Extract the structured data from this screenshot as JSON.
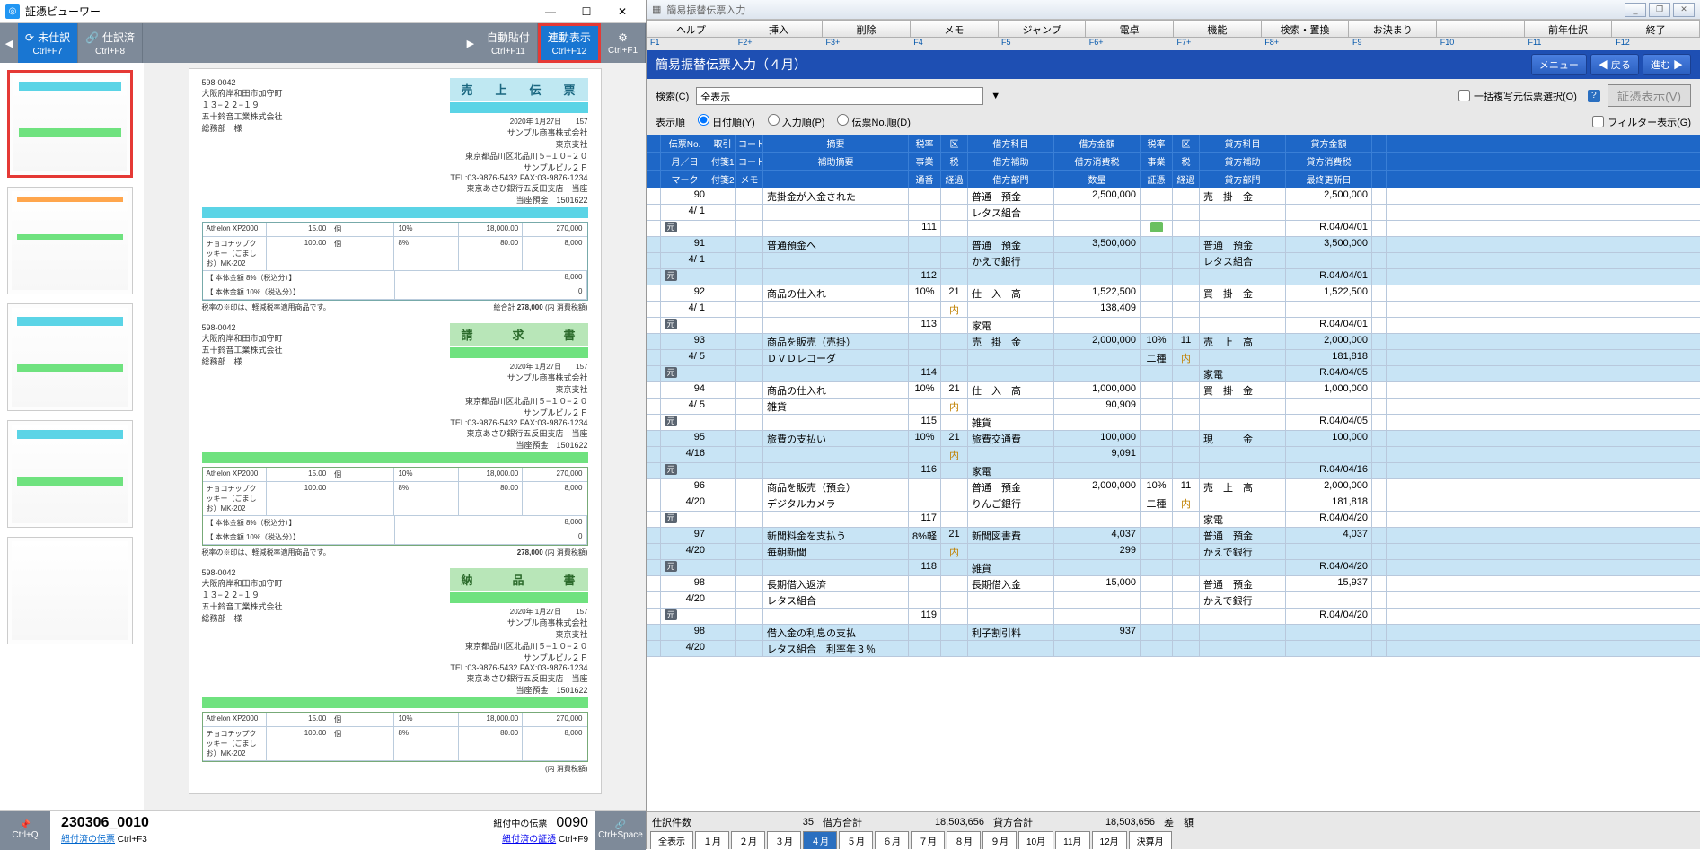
{
  "viewer": {
    "title": "証憑ビューワー",
    "toolbar": {
      "unfinished": "未仕訳",
      "unfinished_key": "Ctrl+F7",
      "finished": "仕訳済",
      "finished_key": "Ctrl+F8",
      "auto_attach": "自動貼付",
      "auto_attach_key": "Ctrl+F11",
      "link_display": "連動表示",
      "link_display_key": "Ctrl+F12",
      "help_key": "Ctrl+F1"
    },
    "doc": {
      "code": "598-0042",
      "addr1": "大阪府岸和田市加守町",
      "addr2": "１３−２２−１９",
      "company": "五十鈴音工業株式会社",
      "dept": "総務部　様",
      "sender": "サンプル商事株式会社",
      "branch": "東京支社",
      "sender_addr": "東京都品川区北品川５−１０−２０",
      "building": "サンプルビル２Ｆ",
      "tel": "TEL:03-9876-5432    FAX:03-9876-1234",
      "bank": "東京あさひ銀行五反田支店　当座",
      "acct": "当座預金　1501622",
      "date": "2020年 1月27日",
      "slip_no": "157",
      "slip1_title": "売　上　伝　票",
      "slip2_title": "請　　求　　書",
      "slip3_title": "納　　品　　書",
      "item1": "Athelon XP2000",
      "item2": "チョコチップクッキー（ごましお）MK-202",
      "base_line1": "【 本体金額 8%（税込分）】",
      "base_line2": "【 本体金額 10%（税込分）】",
      "note": "税率の※印は、軽減税率適用商品です。",
      "qty1": "15.00",
      "qty2": "100.00",
      "unit": "個",
      "rate1": "8%",
      "rate2": "10%",
      "price1": "18,000.00",
      "price2": "80.00",
      "amt1": "270,000",
      "amt2": "8,000",
      "amt3": "0",
      "total": "278,000",
      "tax_label": "(内 消費税額)",
      "subtotal_label": "絵合計"
    },
    "footer": {
      "pin_key": "Ctrl+Q",
      "image_no": "230306_0010",
      "link1": "紐付済の伝票",
      "link1_key": "Ctrl+F3",
      "attach_label": "紐付中の伝票",
      "attach_no": "0090",
      "link2": "紐付済の証憑",
      "link2_key": "Ctrl+F9",
      "space_key": "Ctrl+Space"
    }
  },
  "entry": {
    "title": "簡易振替伝票入力",
    "menus": [
      "ヘルプ",
      "挿入",
      "削除",
      "メモ",
      "ジャンプ",
      "電卓",
      "機能",
      "検索・置換",
      "お決まり",
      "",
      "前年仕訳",
      "終了"
    ],
    "fkeys": [
      "F1",
      "F2+",
      "F3+",
      "F4",
      "F5",
      "F6+",
      "F7+",
      "F8+",
      "F9",
      "F10",
      "F11",
      "F12"
    ],
    "header_title": "簡易振替伝票入力（４月）",
    "btn_menu": "メニュー",
    "btn_back": "◀ 戻る",
    "btn_fwd": "進む ▶",
    "search_label": "検索(C)",
    "search_value": "全表示",
    "bulk_label": "一括複写元伝票選択(O)",
    "evidence_btn": "証憑表示(V)",
    "order_label": "表示順",
    "order_date": "日付順(Y)",
    "order_input": "入力順(P)",
    "order_no": "伝票No.順(D)",
    "filter_label": "フィルター表示(G)",
    "headers": {
      "r1": [
        "伝票No.",
        "取引",
        "コード",
        "摘要",
        "税率",
        "区",
        "借方科目",
        "借方金額",
        "税率",
        "区",
        "貸方科目",
        "貸方金額"
      ],
      "r2": [
        "月／日",
        "付箋1",
        "コード",
        "補助摘要",
        "事業",
        "税",
        "借方補助",
        "借方消費税",
        "事業",
        "税",
        "貸方補助",
        "貸方消費税"
      ],
      "r3": [
        "マーク",
        "付箋2",
        "メモ",
        "",
        "通番",
        "経過",
        "借方部門",
        "数量",
        "証憑",
        "経過",
        "貸方部門",
        "最終更新日"
      ]
    },
    "rows": [
      {
        "no": "90",
        "date": "4/ 1",
        "sum": "売掛金が入金された",
        "rate": "",
        "ku": "",
        "d_acc": "普通　預金",
        "d_amt": "2,500,000",
        "rate2": "",
        "ku2": "",
        "c_acc": "売　掛　金",
        "c_amt": "2,500,000",
        "d_sub": "レタス組合",
        "c_sub": "",
        "seq": "111",
        "evidence": true,
        "upd": "R.04/04/01",
        "highlight": false,
        "mark": "gen"
      },
      {
        "no": "91",
        "date": "4/ 1",
        "sum": "普通預金へ",
        "rate": "",
        "ku": "",
        "d_acc": "普通　預金",
        "d_amt": "3,500,000",
        "rate2": "",
        "ku2": "",
        "c_acc": "普通　預金",
        "c_amt": "3,500,000",
        "d_sub": "かえで銀行",
        "c_sub": "レタス組合",
        "seq": "112",
        "upd": "R.04/04/01",
        "highlight": true,
        "mark": "gen"
      },
      {
        "no": "92",
        "date": "4/ 1",
        "sum": "商品の仕入れ",
        "rate": "10%",
        "ku": "21",
        "d_acc": "仕　入　高",
        "d_amt": "1,522,500",
        "rate2": "",
        "ku2": "",
        "c_acc": "買　掛　金",
        "c_amt": "1,522,500",
        "d_sub": "",
        "d_tax": "138,409",
        "c_sub": "",
        "seq": "113",
        "dept": "家電",
        "upd": "R.04/04/01",
        "highlight": false,
        "mark": "gen",
        "nai": true
      },
      {
        "no": "93",
        "date": "4/ 5",
        "sum": "商品を販売（売掛）",
        "sum2": "ＤＶＤレコーダ",
        "rate": "",
        "ku": "",
        "d_acc": "売　掛　金",
        "d_amt": "2,000,000",
        "rate2": "10%",
        "ku2": "11",
        "c_acc": "売　上　高",
        "c_amt": "2,000,000",
        "c_tax": "181,818",
        "d_sub": "",
        "c_sub": "",
        "seq": "114",
        "c_dept": "家電",
        "upd": "R.04/04/05",
        "highlight": true,
        "mark": "gen",
        "cert": "二種",
        "nai2": true
      },
      {
        "no": "94",
        "date": "4/ 5",
        "sum": "商品の仕入れ",
        "sum2": "雑貨",
        "rate": "10%",
        "ku": "21",
        "d_acc": "仕　入　高",
        "d_amt": "1,000,000",
        "d_tax": "90,909",
        "rate2": "",
        "ku2": "",
        "c_acc": "買　掛　金",
        "c_amt": "1,000,000",
        "seq": "115",
        "dept": "雑貨",
        "upd": "R.04/04/05",
        "highlight": false,
        "mark": "gen",
        "nai": true
      },
      {
        "no": "95",
        "date": "4/16",
        "sum": "旅費の支払い",
        "rate": "10%",
        "ku": "21",
        "d_acc": "旅費交通費",
        "d_amt": "100,000",
        "d_tax": "9,091",
        "rate2": "",
        "ku2": "",
        "c_acc": "現　　　金",
        "c_amt": "100,000",
        "seq": "116",
        "dept": "家電",
        "upd": "R.04/04/16",
        "highlight": true,
        "mark": "gen",
        "nai": true
      },
      {
        "no": "96",
        "date": "4/20",
        "sum": "商品を販売（預金）",
        "sum2": "デジタルカメラ",
        "rate": "",
        "ku": "",
        "d_acc": "普通　預金",
        "d_amt": "2,000,000",
        "d_sub": "りんご銀行",
        "rate2": "10%",
        "ku2": "11",
        "c_acc": "売　上　高",
        "c_amt": "2,000,000",
        "c_tax": "181,818",
        "seq": "117",
        "c_dept": "家電",
        "upd": "R.04/04/20",
        "highlight": false,
        "mark": "gen",
        "cert": "二種",
        "nai2": true
      },
      {
        "no": "97",
        "date": "4/20",
        "sum": "新聞料金を支払う",
        "sum2": "毎朝新聞",
        "rate": "8%軽",
        "ku": "21",
        "d_acc": "新聞図書費",
        "d_amt": "4,037",
        "d_tax": "299",
        "rate2": "",
        "ku2": "",
        "c_acc": "普通　預金",
        "c_amt": "4,037",
        "c_sub": "かえで銀行",
        "seq": "118",
        "dept": "雑貨",
        "upd": "R.04/04/20",
        "highlight": true,
        "mark": "gen",
        "nai": true
      },
      {
        "no": "98",
        "date": "4/20",
        "sum": "長期借入返済",
        "sum2": "レタス組合",
        "rate": "",
        "ku": "",
        "d_acc": "長期借入金",
        "d_amt": "15,000",
        "rate2": "",
        "ku2": "",
        "c_acc": "普通　預金",
        "c_amt": "15,937",
        "c_sub": "かえで銀行",
        "seq": "119",
        "upd": "R.04/04/20",
        "highlight": false,
        "mark": "gen"
      },
      {
        "no": "98",
        "date": "4/20",
        "sum": "借入金の利息の支払",
        "sum2": "レタス組合　利率年３％",
        "rate": "",
        "ku": "",
        "d_acc": "利子割引料",
        "d_amt": "937",
        "rate2": "",
        "ku2": "",
        "c_acc": "",
        "c_amt": "",
        "highlight": true,
        "partial": true
      }
    ],
    "footer": {
      "count_lbl": "仕訳件数",
      "count": "35",
      "debit_lbl": "借方合計",
      "debit": "18,503,656",
      "credit_lbl": "貸方合計",
      "credit": "18,503,656",
      "diff_lbl": "差　額"
    },
    "months": [
      "全表示",
      "１月",
      "２月",
      "３月",
      "４月",
      "５月",
      "６月",
      "７月",
      "８月",
      "９月",
      "10月",
      "11月",
      "12月",
      "決算月"
    ],
    "active_month": 4
  }
}
